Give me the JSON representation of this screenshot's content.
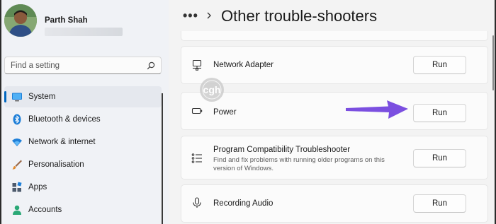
{
  "user": {
    "name": "Parth Shah"
  },
  "search": {
    "placeholder": "Find a setting"
  },
  "nav": [
    {
      "label": "System",
      "icon": "system-monitor-icon",
      "active": true
    },
    {
      "label": "Bluetooth & devices",
      "icon": "bluetooth-icon"
    },
    {
      "label": "Network & internet",
      "icon": "wifi-icon"
    },
    {
      "label": "Personalisation",
      "icon": "paintbrush-icon"
    },
    {
      "label": "Apps",
      "icon": "apps-icon"
    },
    {
      "label": "Accounts",
      "icon": "accounts-icon"
    }
  ],
  "breadcrumb": {
    "dots": "•••",
    "title": "Other trouble-shooters"
  },
  "troubleshooters": [
    {
      "title": "Network Adapter",
      "icon": "network-adapter-icon",
      "button": "Run"
    },
    {
      "title": "Power",
      "icon": "battery-icon",
      "button": "Run"
    },
    {
      "title": "Program Compatibility Troubleshooter",
      "description": "Find and fix problems with running older programs on this version of Windows.",
      "icon": "list-icon",
      "button": "Run"
    },
    {
      "title": "Recording Audio",
      "icon": "microphone-icon",
      "button": "Run"
    }
  ],
  "watermark": {
    "text": "cgh"
  },
  "colors": {
    "accent": "#0067c0",
    "arrow": "#7b4fe0"
  }
}
